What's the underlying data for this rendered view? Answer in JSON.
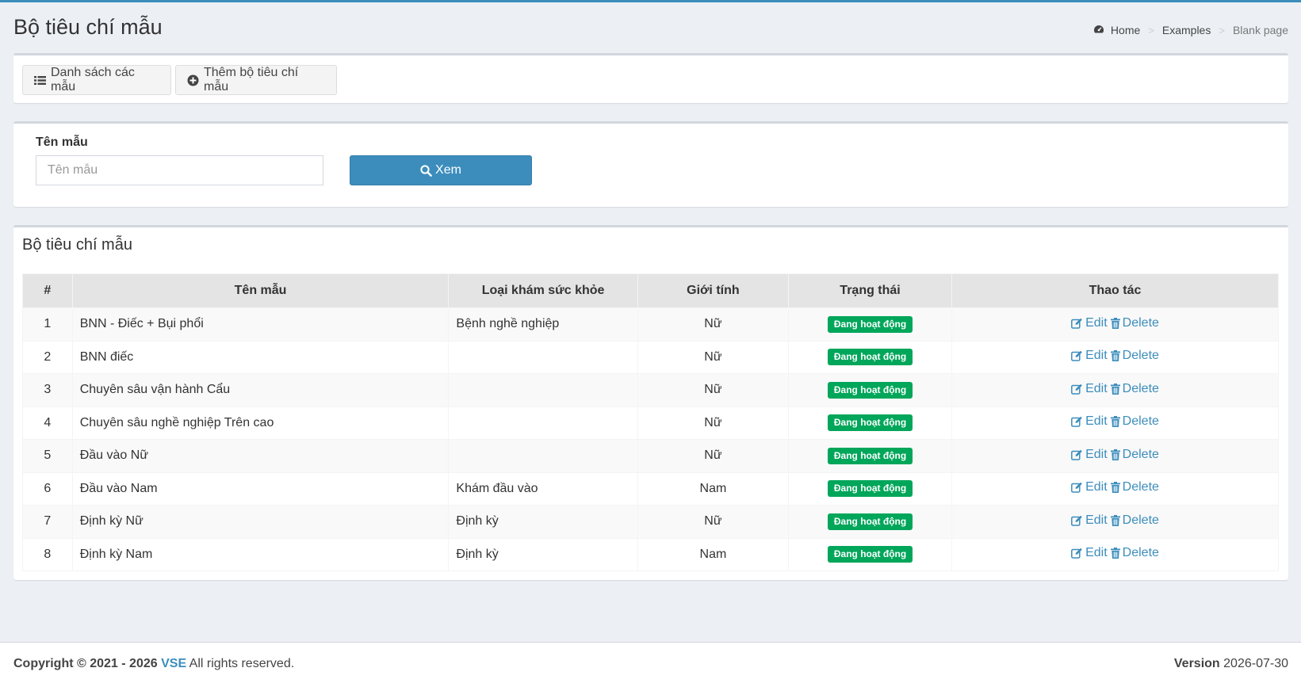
{
  "header": {
    "title": "Bộ tiêu chí mẫu",
    "breadcrumb": [
      "Home",
      "Examples",
      "Blank page"
    ]
  },
  "toolbar": {
    "list_label": "Danh sách các mẫu",
    "add_label": "Thêm bộ tiêu chí mẫu"
  },
  "filter": {
    "label": "Tên mẫu",
    "placeholder": "Tên mẫu",
    "value": "",
    "search_label": "Xem"
  },
  "list": {
    "title": "Bộ tiêu chí mẫu",
    "columns": [
      "#",
      "Tên mẫu",
      "Loại khám sức khỏe",
      "Giới tính",
      "Trạng thái",
      "Thao tác"
    ],
    "rows": [
      {
        "no": "1",
        "name": "BNN - Điếc + Bụi phổi",
        "type": "Bệnh nghề nghiệp",
        "gender": "Nữ",
        "status": "Đang hoạt động"
      },
      {
        "no": "2",
        "name": "BNN điếc",
        "type": "",
        "gender": "Nữ",
        "status": "Đang hoạt động"
      },
      {
        "no": "3",
        "name": "Chuyên sâu vận hành Cẩu",
        "type": "",
        "gender": "Nữ",
        "status": "Đang hoạt động"
      },
      {
        "no": "4",
        "name": "Chuyên sâu nghề nghiệp Trên cao",
        "type": "",
        "gender": "Nữ",
        "status": "Đang hoạt động"
      },
      {
        "no": "5",
        "name": "Đầu vào Nữ",
        "type": "",
        "gender": "Nữ",
        "status": "Đang hoạt động"
      },
      {
        "no": "6",
        "name": "Đầu vào Nam",
        "type": "Khám đầu vào",
        "gender": "Nam",
        "status": "Đang hoạt động"
      },
      {
        "no": "7",
        "name": "Định kỳ Nữ",
        "type": "Định kỳ",
        "gender": "Nữ",
        "status": "Đang hoạt động"
      },
      {
        "no": "8",
        "name": "Định kỳ Nam",
        "type": "Định kỳ",
        "gender": "Nam",
        "status": "Đang hoạt động"
      }
    ],
    "edit_label": "Edit",
    "delete_label": "Delete"
  },
  "footer": {
    "copyright": "Copyright © 2021 - 2026",
    "brand": "VSE",
    "rights": "All rights reserved.",
    "version_label": "Version",
    "version": "2026-07-30"
  },
  "colors": {
    "accent": "#3c8dbc",
    "success": "#00a65a",
    "background": "#ecf0f5"
  },
  "icons": {
    "breadcrumb_home": "dashboard-icon",
    "list_button": "list-icon",
    "add_button": "plus-circle-icon",
    "search_button": "search-icon",
    "edit_action": "edit-icon",
    "delete_action": "trash-icon"
  }
}
